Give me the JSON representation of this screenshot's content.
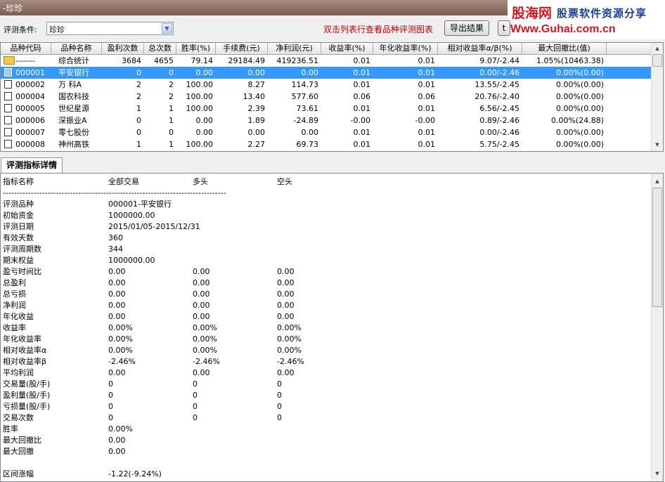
{
  "window": {
    "title": "-珍珍"
  },
  "brand": {
    "name": "股海网",
    "slogan": "股票软件资源分享",
    "url": "Www.Guhai.com.cn"
  },
  "toolbar": {
    "condition_label": "评测条件:",
    "condition_value": "珍珍",
    "hint": "双击列表行查看品种评测图表",
    "export_label": "导出结果",
    "other_label": "t"
  },
  "table": {
    "columns": [
      "品种代码",
      "品种名称",
      "盈利次数",
      "总次数",
      "胜率(%)",
      "手续费(元)",
      "净利润(元)",
      "收益率(%)",
      "年化收益率(%)",
      "相对收益率α/β(%)",
      "最大回撤比(值)"
    ],
    "rows": [
      {
        "code": "-------",
        "name": "综合统计",
        "win": "3684",
        "total": "4655",
        "rate": "79.14",
        "fee": "29184.49",
        "profit": "419236.51",
        "ret": "0.01",
        "annual": "0.01",
        "rel": "9.07/-2.44",
        "dd": "1.05%(10463.38)"
      },
      {
        "code": "000001",
        "name": "平安银行",
        "win": "0",
        "total": "0",
        "rate": "0.00",
        "fee": "0.00",
        "profit": "0.00",
        "ret": "0.01",
        "annual": "0.01",
        "rel": "0.00/-2.46",
        "dd": "0.00%(0.00)"
      },
      {
        "code": "000002",
        "name": "万  科A",
        "win": "2",
        "total": "2",
        "rate": "100.00",
        "fee": "8.27",
        "profit": "114.73",
        "ret": "0.01",
        "annual": "0.01",
        "rel": "13.55/-2.45",
        "dd": "0.00%(0.00)"
      },
      {
        "code": "000004",
        "name": "国农科技",
        "win": "2",
        "total": "2",
        "rate": "100.00",
        "fee": "13.40",
        "profit": "577.60",
        "ret": "0.06",
        "annual": "0.06",
        "rel": "20.76/-2.40",
        "dd": "0.00%(0.00)"
      },
      {
        "code": "000005",
        "name": "世纪星源",
        "win": "1",
        "total": "1",
        "rate": "100.00",
        "fee": "2.39",
        "profit": "73.61",
        "ret": "0.01",
        "annual": "0.01",
        "rel": "6.56/-2.45",
        "dd": "0.00%(0.00)"
      },
      {
        "code": "000006",
        "name": "深振业A",
        "win": "0",
        "total": "1",
        "rate": "0.00",
        "fee": "1.89",
        "profit": "-24.89",
        "ret": "-0.00",
        "annual": "-0.00",
        "rel": "0.89/-2.46",
        "dd": "0.00%(24.88)"
      },
      {
        "code": "000007",
        "name": "零七股份",
        "win": "0",
        "total": "0",
        "rate": "0.00",
        "fee": "0.00",
        "profit": "0.00",
        "ret": "0.01",
        "annual": "0.01",
        "rel": "0.00/-2.46",
        "dd": "0.00%(0.00)"
      },
      {
        "code": "000008",
        "name": "神州高铁",
        "win": "1",
        "total": "1",
        "rate": "100.00",
        "fee": "2.27",
        "profit": "69.73",
        "ret": "0.01",
        "annual": "0.01",
        "rel": "5.75/-2.45",
        "dd": "0.00%(0.00)"
      }
    ]
  },
  "detail": {
    "tab_label": "评测指标详情",
    "headers": [
      "指标名称",
      "全部交易",
      "多头",
      "空头"
    ],
    "divider": "--------------------------------------------------------------------------------",
    "lines": [
      [
        "评测品种",
        "000001-平安银行",
        "",
        ""
      ],
      [
        "初始资金",
        "1000000.00",
        "",
        ""
      ],
      [
        "评测日期",
        "2015/01/05-2015/12/31",
        "",
        ""
      ],
      [
        "有效天数",
        "360",
        "",
        ""
      ],
      [
        "评测周期数",
        "344",
        "",
        ""
      ],
      [
        "期末权益",
        "1000000.00",
        "",
        ""
      ],
      [
        "盈亏时间比",
        "0.00",
        "0.00",
        "0.00"
      ],
      [
        "总盈利",
        "0.00",
        "0.00",
        "0.00"
      ],
      [
        "总亏损",
        "0.00",
        "0.00",
        "0.00"
      ],
      [
        "净利润",
        "0.00",
        "0.00",
        "0.00"
      ],
      [
        "年化收益",
        "0.00",
        "0.00",
        "0.00"
      ],
      [
        "收益率",
        "0.00%",
        "0.00%",
        "0.00%"
      ],
      [
        "年化收益率",
        "0.00%",
        "0.00%",
        "0.00%"
      ],
      [
        "相对收益率α",
        "0.00%",
        "0.00%",
        "0.00%"
      ],
      [
        "相对收益率β",
        "-2.46%",
        "-2.46%",
        "-2.46%"
      ],
      [
        "平均利润",
        "0.00",
        "0.00",
        "0.00"
      ],
      [
        "交易量(股/手)",
        "0",
        "0",
        "0"
      ],
      [
        "盈利量(股/手)",
        "0",
        "0",
        "0"
      ],
      [
        "亏损量(股/手)",
        "0",
        "0",
        "0"
      ],
      [
        "交易次数",
        "0",
        "0",
        "0"
      ],
      [
        "胜率",
        "0.00%",
        "",
        ""
      ],
      [
        "最大回撤比",
        "0.00",
        "",
        ""
      ],
      [
        "最大回撤",
        "0.00",
        "",
        ""
      ],
      [
        "",
        "",
        " ",
        ""
      ],
      [
        "区间涨幅",
        "-1.22(-9.24%)",
        "",
        ""
      ]
    ]
  }
}
